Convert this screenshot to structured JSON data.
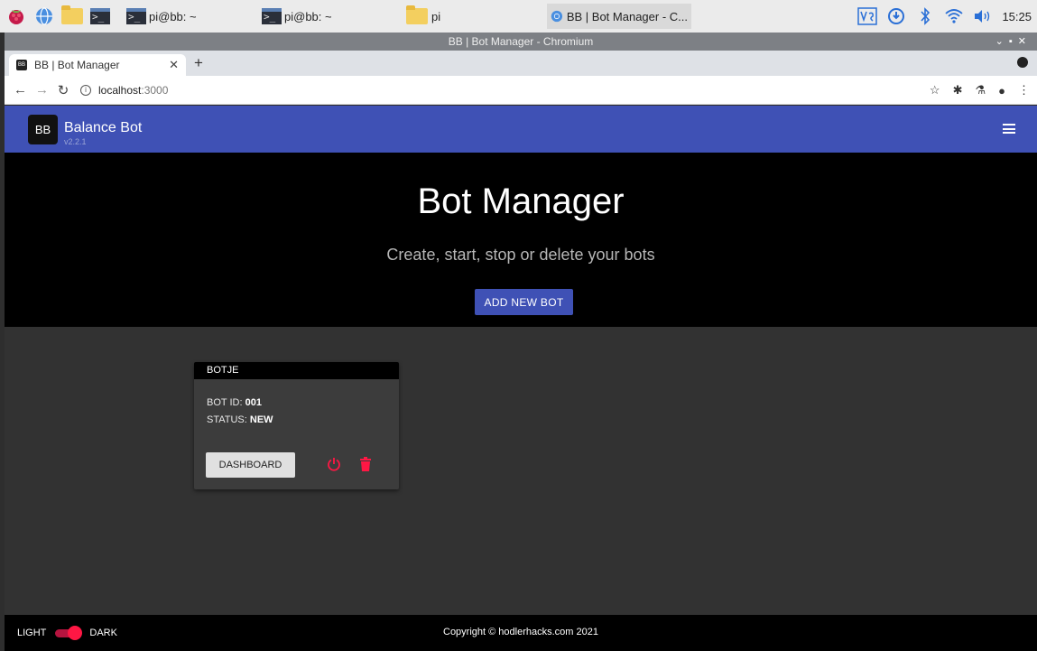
{
  "taskbar": {
    "tasks": [
      {
        "label": "pi@bb: ~",
        "icon": "terminal-icon"
      },
      {
        "label": "pi@bb: ~",
        "icon": "terminal-icon"
      },
      {
        "label": "pi",
        "icon": "folder-icon"
      },
      {
        "label": "BB | Bot Manager - C...",
        "icon": "chromium-icon"
      }
    ],
    "clock": "15:25"
  },
  "window": {
    "title": "BB | Bot Manager - Chromium",
    "tab_title": "BB | Bot Manager",
    "favicon_text": "BB",
    "url_host": "localhost",
    "url_rest": ":3000"
  },
  "app": {
    "logo_text": "BB",
    "brand": "Balance Bot",
    "version": "v2.2.1",
    "hero_title": "Bot Manager",
    "hero_subtitle": "Create, start, stop or delete your bots",
    "add_button": "ADD NEW BOT",
    "accent_color": "#3f51b5",
    "danger_color": "#ff1744",
    "bots": [
      {
        "name": "BOTJE",
        "id_label": "BOT ID:",
        "id": "001",
        "status_label": "STATUS:",
        "status": "NEW",
        "dashboard_label": "DASHBOARD"
      }
    ],
    "footer": {
      "light_label": "LIGHT",
      "dark_label": "DARK",
      "copyright": "Copyright © hodlerhacks.com 2021"
    }
  }
}
